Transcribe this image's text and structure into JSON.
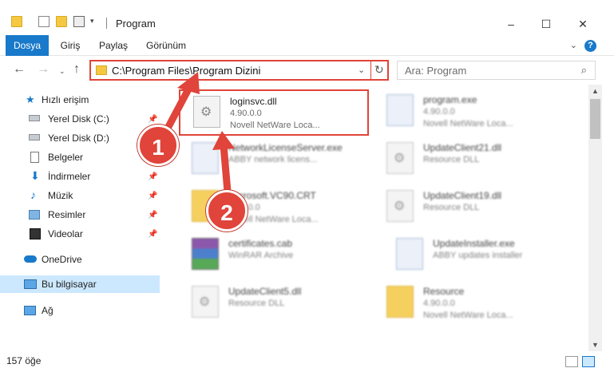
{
  "window": {
    "title": "Program",
    "controls": {
      "minimize": "–",
      "maximize": "☐",
      "close": "✕"
    }
  },
  "ribbon": {
    "tabs": [
      {
        "label": "Dosya",
        "active": true
      },
      {
        "label": "Giriş"
      },
      {
        "label": "Paylaş"
      },
      {
        "label": "Görünüm"
      }
    ],
    "help": "?"
  },
  "address": {
    "path": "C:\\Program Files\\Program Dizini",
    "search_placeholder": "Ara: Program"
  },
  "nav": {
    "items": [
      {
        "label": "Hızlı erişim",
        "icon": "star-icon"
      },
      {
        "label": "Yerel Disk (C:)",
        "icon": "drive-icon",
        "pinned": true
      },
      {
        "label": "Yerel Disk (D:)",
        "icon": "drive-icon"
      },
      {
        "label": "Belgeler",
        "icon": "documents-icon"
      },
      {
        "label": "İndirmeler",
        "icon": "download-icon",
        "pinned": true
      },
      {
        "label": "Müzik",
        "icon": "music-icon",
        "pinned": true
      },
      {
        "label": "Resimler",
        "icon": "pictures-icon",
        "pinned": true
      },
      {
        "label": "Videolar",
        "icon": "video-icon",
        "pinned": true
      },
      {
        "label": "OneDrive",
        "icon": "cloud-icon"
      },
      {
        "label": "Bu bilgisayar",
        "icon": "computer-icon",
        "selected": true
      },
      {
        "label": "Ağ",
        "icon": "network-icon"
      }
    ]
  },
  "files": [
    {
      "name": "loginsvc.dll",
      "line1": "4.90.0.0",
      "line2": "Novell NetWare Loca...",
      "icon": "dll-gear-icon",
      "highlighted": true
    },
    {
      "name": "program.exe",
      "line1": "4.90.0.0",
      "line2": "Novell NetWare Loca...",
      "icon": "exe-icon"
    },
    {
      "name": "NetworkLicenseServer.exe",
      "line1": "ABBY network licens...",
      "line2": "",
      "icon": "exe-icon"
    },
    {
      "name": "UpdateClient21.dll",
      "line1": "Resource DLL",
      "line2": "",
      "icon": "dll-gear-icon"
    },
    {
      "name": "Microsoft.VC90.CRT",
      "line1": "4.90.0.0",
      "line2": "Novell NetWare Loca...",
      "icon": "folder-icon"
    },
    {
      "name": "UpdateClient19.dll",
      "line1": "Resource DLL",
      "line2": "",
      "icon": "dll-gear-icon"
    },
    {
      "name": "certificates.cab",
      "line1": "WinRAR Archive",
      "line2": "",
      "icon": "rar-icon"
    },
    {
      "name": "UpdateInstaller.exe",
      "line1": "ABBY updates installer",
      "line2": "",
      "icon": "exe-icon"
    },
    {
      "name": "UpdateClient5.dll",
      "line1": "Resource DLL",
      "line2": "",
      "icon": "dll-gear-icon"
    },
    {
      "name": "Resource",
      "line1": "4.90.0.0",
      "line2": "Novell NetWare Loca...",
      "icon": "folder-icon"
    }
  ],
  "status": {
    "count_text": "157 öğe"
  },
  "annotations": {
    "step1": "1",
    "step2": "2"
  },
  "colors": {
    "accent": "#1979ca",
    "highlight_red": "#e0443a",
    "selected_bg": "#cce8ff"
  }
}
